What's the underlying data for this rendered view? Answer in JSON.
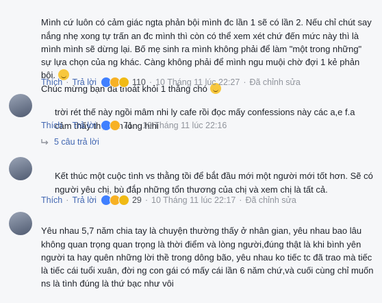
{
  "comments": [
    {
      "text": "Mình cứ luôn có cảm giác ngta phản bội mình đc lần 1 sẽ có lần 2. Nếu chỉ chút say nắng nhẹ xong tự trấn an đc mình thì còn có thể xem xét chứ đến mức này thì là mình mình sẽ dừng lại. Bố mẹ sinh ra mình không phải để làm \"một trong những\" sự lựa chọn của ng khác. Càng không phải để mình ngu muội chờ đợi 1 kẻ phản bội.",
      "text2": "Chúc mừng bạn đã thoát khỏi 1 thằng chó",
      "like": "Thích",
      "reply": "Trả lời",
      "reactions": [
        "like",
        "haha",
        "sad"
      ],
      "count": "110",
      "time": "10 Tháng 11 lúc 22:27",
      "edited": "Đã chỉnh sửa"
    },
    {
      "text": "trời rét thế này ngồi mâm nhi ly cafe rồi đọc mấy confessions này các a,e f.a cảm thấy thật ấm lòng hihi",
      "like": "Thích",
      "reply": "Trả lời",
      "reactions": [
        "like",
        "haha"
      ],
      "count": "71",
      "time": "10 Tháng 11 lúc 22:16",
      "replies": "5 câu trả lời"
    },
    {
      "text": "Kết thúc một cuộc tình vs thằng tồi để bắt đầu mới một người mới tốt hơn. Sẽ có người yêu chị, bù đắp những tổn thương của chị và xem chị là tất cả.",
      "like": "Thích",
      "reply": "Trả lời",
      "reactions": [
        "like",
        "haha",
        "sad"
      ],
      "count": "29",
      "time": "10 Tháng 11 lúc 22:17",
      "edited": "Đã chỉnh sửa"
    },
    {
      "text": "Yêu nhau 5,7 năm chia tay là chuyện thường thấy ở nhân gian, yêu nhau bao lâu không quan trọng quan trọng là thời điểm và lòng người,đúng thật là khi bình yên người ta hay quên những lời thề trong dông bão, yêu nhau ko tiếc tc đã trao mà tiếc là tiếc cái tuổi xuân, đời ng con gái có mấy cái lần 6 năm chứ,và cuối cùng chỉ muốn ns là tình đúng là thứ bạc như vôi"
    }
  ]
}
